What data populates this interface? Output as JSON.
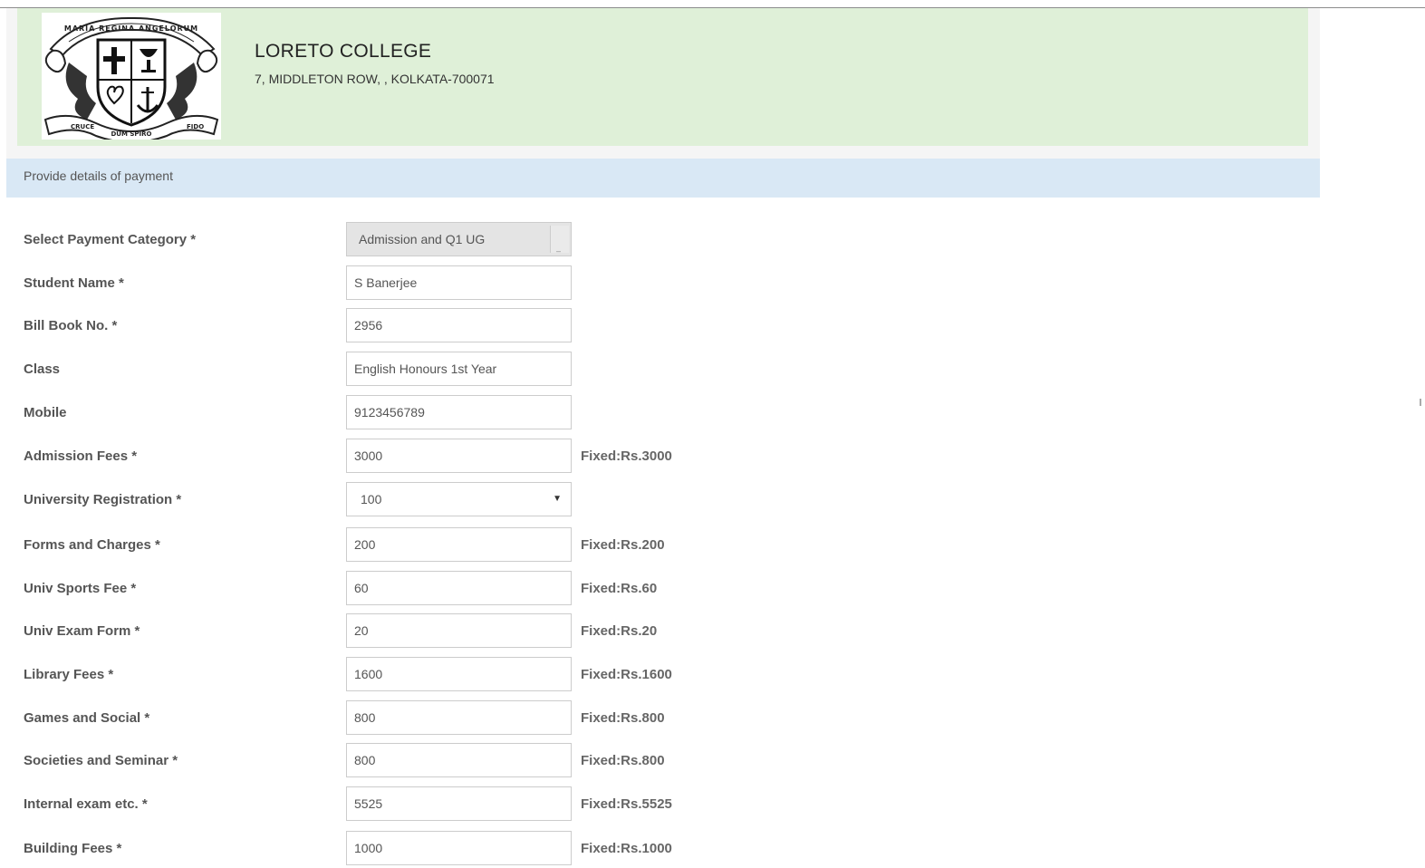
{
  "header": {
    "college_name": "LORETO COLLEGE",
    "address": "7, MIDDLETON ROW, , KOLKATA-700071",
    "logo_text": [
      "MARIA REGINA ANGELORUM",
      "CRUCE",
      "DUM SPIRO",
      "FIDO"
    ]
  },
  "section": {
    "title": "Provide details of payment"
  },
  "form": {
    "rows": [
      {
        "label": "Select Payment Category *",
        "value": "Admission and Q1 UG",
        "kind": "select-disabled",
        "fixed": ""
      },
      {
        "label": "Student Name *",
        "value": "S Banerjee",
        "kind": "input",
        "fixed": ""
      },
      {
        "label": "Bill Book No. *",
        "value": "2956",
        "kind": "input",
        "fixed": ""
      },
      {
        "label": "Class",
        "value": "English Honours 1st Year",
        "kind": "input",
        "fixed": ""
      },
      {
        "label": "Mobile",
        "value": "9123456789",
        "kind": "input",
        "fixed": ""
      },
      {
        "label": "Admission Fees *",
        "value": "3000",
        "kind": "input",
        "fixed": "Fixed:Rs.3000"
      },
      {
        "label": "University Registration *",
        "value": "100",
        "kind": "select",
        "fixed": ""
      },
      {
        "label": "Forms and Charges *",
        "value": "200",
        "kind": "input",
        "fixed": "Fixed:Rs.200"
      },
      {
        "label": "Univ Sports Fee *",
        "value": "60",
        "kind": "input",
        "fixed": "Fixed:Rs.60"
      },
      {
        "label": "Univ Exam Form *",
        "value": "20",
        "kind": "input",
        "fixed": "Fixed:Rs.20"
      },
      {
        "label": "Library Fees *",
        "value": "1600",
        "kind": "input",
        "fixed": "Fixed:Rs.1600"
      },
      {
        "label": "Games and Social *",
        "value": "800",
        "kind": "input",
        "fixed": "Fixed:Rs.800"
      },
      {
        "label": "Societies and Seminar *",
        "value": "800",
        "kind": "input",
        "fixed": "Fixed:Rs.800"
      },
      {
        "label": "Internal exam etc. *",
        "value": "5525",
        "kind": "input",
        "fixed": "Fixed:Rs.5525"
      },
      {
        "label": "Building Fees *",
        "value": "1000",
        "kind": "input",
        "fixed": "Fixed:Rs.1000"
      }
    ]
  }
}
